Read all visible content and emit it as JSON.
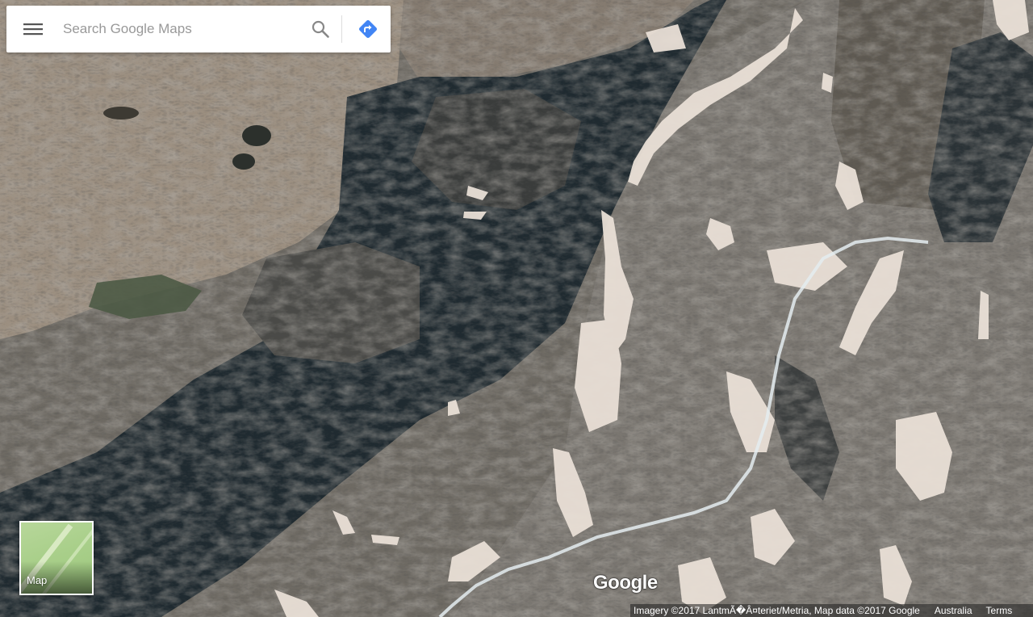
{
  "search": {
    "placeholder": "Search Google Maps"
  },
  "icons": {
    "menu": "hamburger-menu-icon",
    "search": "search-icon",
    "directions": "directions-icon"
  },
  "colors": {
    "directions_accent": "#4285f4",
    "searchbox_background": "#ffffff"
  },
  "layer_toggle": {
    "label": "Map"
  },
  "logo": {
    "text": "Google"
  },
  "attribution": {
    "imagery": "Imagery ©2017 LantmÃ�Â¤teriet/Metria, Map data ©2017 Google",
    "region": "Australia",
    "terms": "Terms"
  },
  "map": {
    "view": "satellite"
  }
}
